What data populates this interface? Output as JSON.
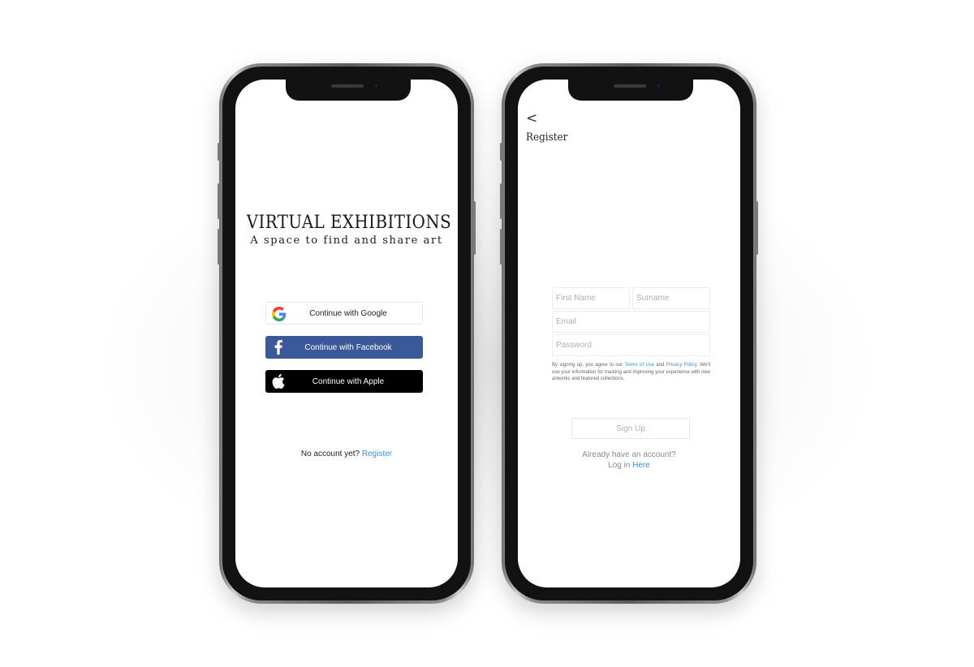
{
  "login_screen": {
    "title": "VIRTUAL EXHIBITIONS",
    "subtitle": "A space to find and share art",
    "google_label": "Continue with Google",
    "facebook_label": "Continue with Facebook",
    "apple_label": "Continue with Apple",
    "no_account_text": "No account yet?",
    "register_link": "Register"
  },
  "register_screen": {
    "back_symbol": "<",
    "title": "Register",
    "first_name_placeholder": "First Name",
    "surname_placeholder": "Surname",
    "email_placeholder": "Email",
    "password_placeholder": "Password",
    "terms_prefix": "By signing up, you agree to our",
    "terms_link": "Terms of Use",
    "terms_and": "and",
    "privacy_link": "Privacy Policy",
    "terms_suffix": ". We'll use your information for tracking and improving your experience with new artworks and featured collections.",
    "signup_label": "Sign Up",
    "already_text": "Already have an account?",
    "login_prefix": "Log in",
    "login_link": "Here"
  },
  "colors": {
    "facebook": "#3b5998",
    "apple": "#000000",
    "link": "#3a8fd8"
  },
  "icons": {
    "google": "google-logo-icon",
    "facebook": "facebook-logo-icon",
    "apple": "apple-logo-icon"
  }
}
